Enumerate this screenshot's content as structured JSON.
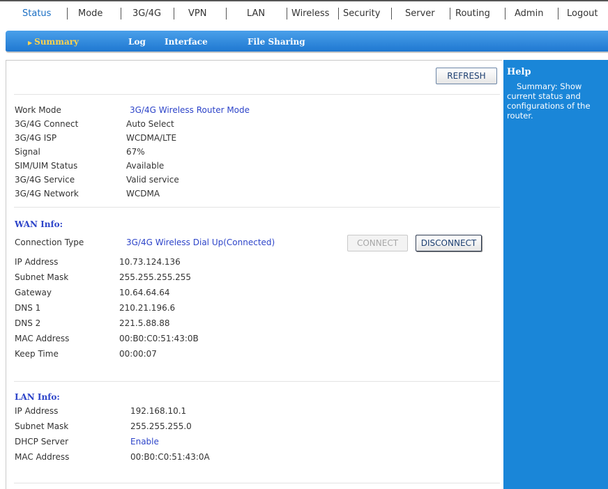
{
  "topnav": {
    "items": [
      "Status",
      "Mode",
      "3G/4G",
      "VPN",
      "LAN",
      "Wireless",
      "Security",
      "Server",
      "Routing",
      "Admin",
      "Logout"
    ],
    "active": "Status"
  },
  "subnav": {
    "tabs": [
      "Summary",
      "Log",
      "Interface",
      "File Sharing"
    ],
    "active": "Summary"
  },
  "refresh_label": "REFRESH",
  "status": {
    "rows": [
      {
        "label": "Work Mode",
        "value": "3G/4G Wireless Router Mode"
      },
      {
        "label": "3G/4G Connect",
        "value": "Auto Select"
      },
      {
        "label": "3G/4G ISP",
        "value": "WCDMA/LTE"
      },
      {
        "label": "Signal",
        "value": "67%"
      },
      {
        "label": "SIM/UIM Status",
        "value": "Available"
      },
      {
        "label": "3G/4G Service",
        "value": "Valid service"
      },
      {
        "label": "3G/4G Network",
        "value": "WCDMA"
      }
    ]
  },
  "wan": {
    "title": "WAN Info:",
    "rows": [
      {
        "label": "Connection Type",
        "value": "3G/4G Wireless Dial Up(Connected)"
      },
      {
        "label": "IP Address",
        "value": "10.73.124.136"
      },
      {
        "label": "Subnet Mask",
        "value": "255.255.255.255"
      },
      {
        "label": "Gateway",
        "value": "10.64.64.64"
      },
      {
        "label": "DNS 1",
        "value": "210.21.196.6"
      },
      {
        "label": "DNS 2",
        "value": "221.5.88.88"
      },
      {
        "label": "MAC Address",
        "value": "00:B0:C0:51:43:0B"
      },
      {
        "label": "Keep Time",
        "value": "00:00:07"
      }
    ],
    "connect_label": "CONNECT",
    "disconnect_label": "DISCONNECT"
  },
  "lan": {
    "title": "LAN Info:",
    "rows": [
      {
        "label": "IP Address",
        "value": "192.168.10.1"
      },
      {
        "label": "Subnet Mask",
        "value": "255.255.255.0"
      },
      {
        "label": "DHCP Server",
        "value": "Enable"
      },
      {
        "label": "MAC Address",
        "value": "00:B0:C0:51:43:0A"
      }
    ]
  },
  "help": {
    "title": "Help",
    "text": "Summary: Show current status and configurations of the router."
  },
  "colors": {
    "link_blue": "#2d44c9",
    "nav_active": "#1a6fc4",
    "help_bg": "#1a86d8",
    "subnav_active": "#ffd34d"
  }
}
